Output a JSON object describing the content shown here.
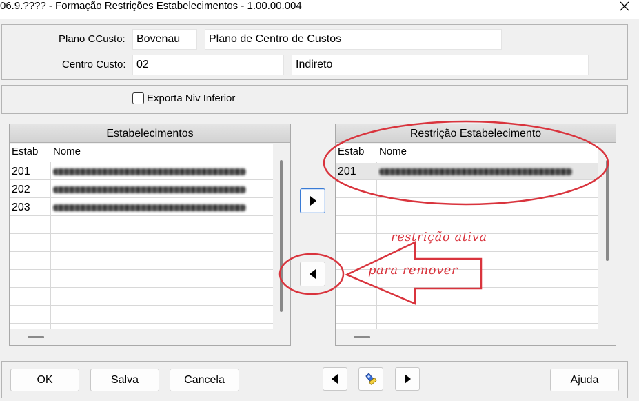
{
  "window": {
    "title": "06.9.???? - Formação Restrições Estabelecimentos - 1.00.00.004",
    "close_icon": "close-icon"
  },
  "header": {
    "plano_label": "Plano CCusto:",
    "plano_code": "Bovenau",
    "plano_desc": "Plano de Centro de Custos",
    "centro_label": "Centro Custo:",
    "centro_code": "02",
    "centro_desc": "Indireto"
  },
  "options": {
    "exporta_label": "Exporta Niv Inferior",
    "exporta_checked": false
  },
  "left_list": {
    "title": "Estabelecimentos",
    "columns": [
      "Estab",
      "Nome"
    ],
    "rows": [
      {
        "estab": "201",
        "nome": "",
        "nome_redacted": true
      },
      {
        "estab": "202",
        "nome": "",
        "nome_redacted": true
      },
      {
        "estab": "203",
        "nome": "",
        "nome_redacted": true
      }
    ]
  },
  "right_list": {
    "title": "Restrição Estabelecimento",
    "columns": [
      "Estab",
      "Nome"
    ],
    "rows": [
      {
        "estab": "201",
        "nome": "",
        "nome_redacted": true,
        "selected": true
      }
    ]
  },
  "transfer": {
    "add_icon": "triangle-right-icon",
    "remove_icon": "triangle-left-icon"
  },
  "annotations": {
    "active_text": "restrição ativa",
    "remove_text": "para remover",
    "color": "#d9343d"
  },
  "footer": {
    "ok_label": "OK",
    "salva_label": "Salva",
    "cancela_label": "Cancela",
    "prev_icon": "triangle-left-icon",
    "search_icon": "flashlight-icon",
    "next_icon": "triangle-right-icon",
    "ajuda_label": "Ajuda"
  }
}
